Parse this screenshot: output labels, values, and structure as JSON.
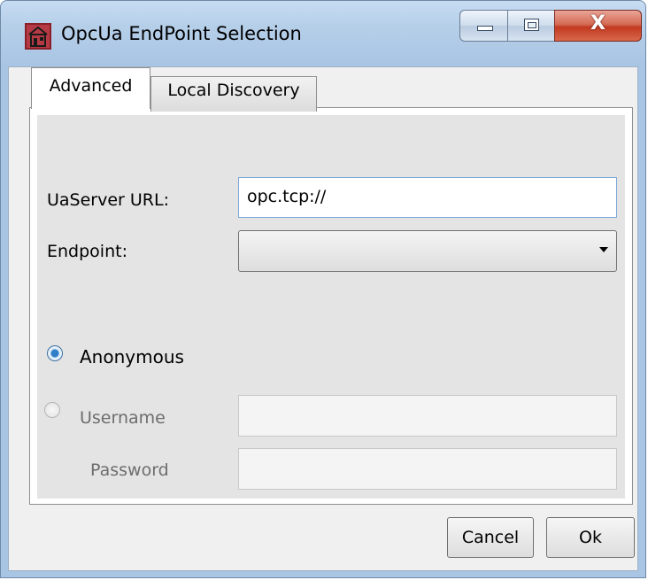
{
  "window": {
    "title": "OpcUa EndPoint Selection",
    "app_icon": "building-icon",
    "controls": {
      "minimize": "minimize-icon",
      "maximize": "maximize-icon",
      "close": "X"
    }
  },
  "tabs": [
    {
      "label": "Advanced",
      "selected": true
    },
    {
      "label": "Local Discovery",
      "selected": false
    }
  ],
  "form": {
    "server_url_label": "UaServer URL:",
    "server_url_value": "opc.tcp://",
    "endpoint_label": "Endpoint:",
    "endpoint_value": "",
    "auth_anonymous_label": "Anonymous",
    "auth_anonymous_selected": true,
    "auth_username_label": "Username",
    "auth_username_selected": false,
    "username_value": "",
    "password_label": "Password",
    "password_value": ""
  },
  "buttons": {
    "cancel": "Cancel",
    "ok": "Ok"
  },
  "colors": {
    "title_bar": "#a9c5e4",
    "close_button": "#c23a21",
    "radio_selected": "#2f7ec7"
  }
}
